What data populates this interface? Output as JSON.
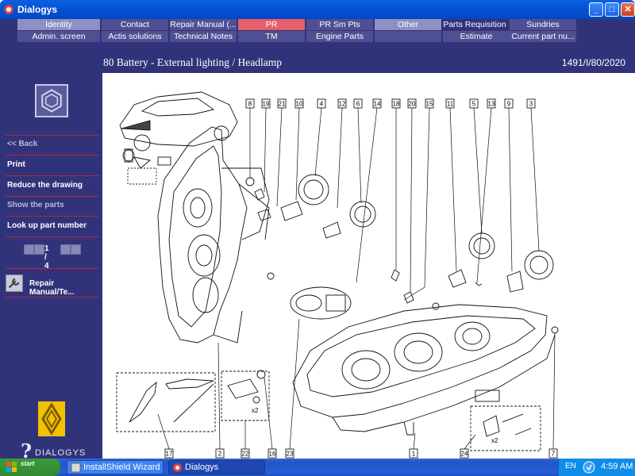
{
  "window": {
    "title": "Dialogys"
  },
  "nav": {
    "row1": [
      "Identity",
      "Contact",
      "Repair Manual (...",
      "PR",
      "PR Sm Pts",
      "Other",
      "Parts Requisition",
      "Sundries"
    ],
    "row2": [
      "Admin. screen",
      "Actis solutions",
      "Technical Notes",
      "TM",
      "Engine Parts",
      "",
      "Estimate",
      "Current part nu..."
    ],
    "active": "PR"
  },
  "sidebar": {
    "items": [
      {
        "label": "<< Back",
        "enabled": false
      },
      {
        "label": "Print",
        "enabled": true
      },
      {
        "label": "Reduce the drawing",
        "enabled": true
      },
      {
        "label": "Show the parts",
        "enabled": false
      },
      {
        "label": "Look up part number",
        "enabled": true
      }
    ],
    "pager": "1 / 4",
    "repair_manual_label": "Repair Manual/Te...",
    "brand_text": "DIALOGYS"
  },
  "header": {
    "title": "80 Battery - External lighting / Headlamp",
    "reference": "1491/I/80/2020"
  },
  "drawing": {
    "top_callouts": [
      "8",
      "19",
      "21",
      "10",
      "4",
      "12",
      "6",
      "14",
      "18",
      "20",
      "15",
      "11",
      "5",
      "13",
      "9",
      "3"
    ],
    "bottom_callouts": [
      "17",
      "2",
      "22",
      "16",
      "23",
      "1",
      "24",
      "7"
    ],
    "notes": [
      "x2",
      "x2"
    ]
  },
  "taskbar": {
    "start_label": "start",
    "tasks": [
      "InstallShield Wizard",
      "Dialogys"
    ],
    "language": "EN",
    "time": "4:59 AM"
  },
  "colors": {
    "app_background": "#31337a",
    "nav_light": "#8f8fc4",
    "nav_dark": "#4f4f93",
    "nav_active": "#e85f6a",
    "separator": "#b0283a"
  }
}
